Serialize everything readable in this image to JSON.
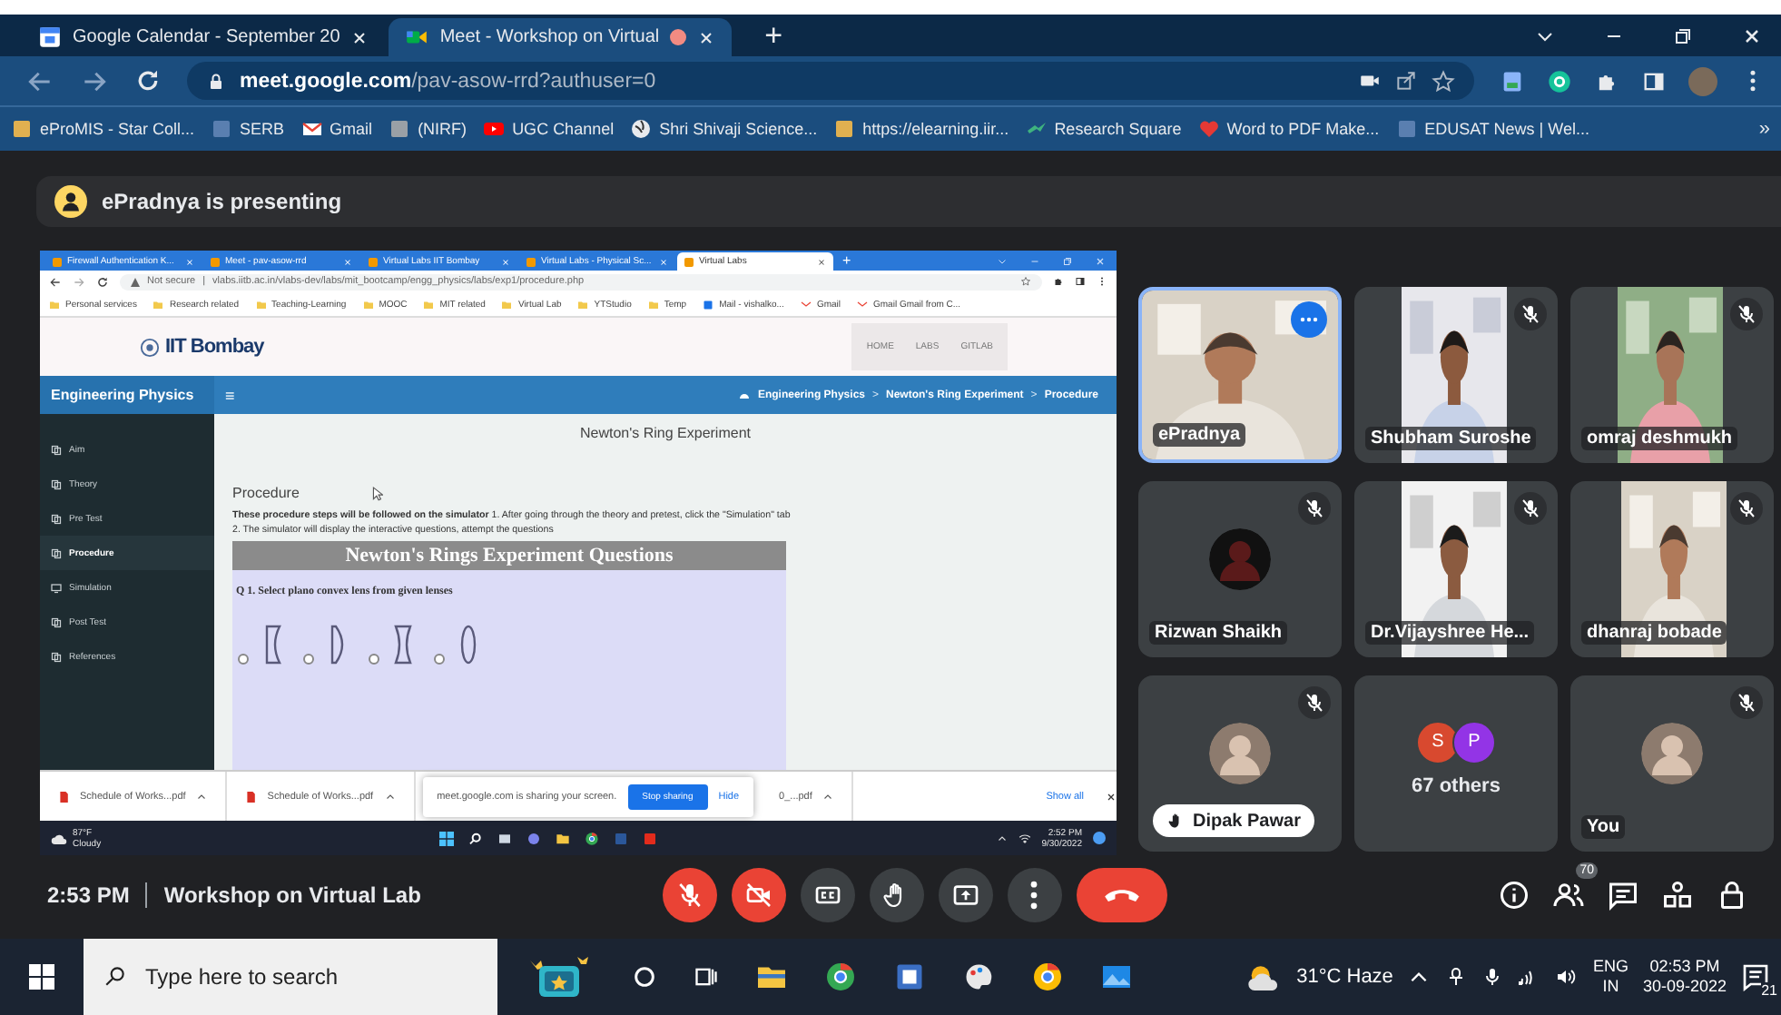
{
  "browser": {
    "tabs": [
      {
        "title": "Google Calendar - September 20",
        "kind": "calendar",
        "selected": false,
        "recording": false
      },
      {
        "title": "Meet - Workshop on Virtual",
        "kind": "meet",
        "selected": true,
        "recording": true
      }
    ],
    "new_tab": "+",
    "url_host": "meet.google.com",
    "url_path": "/pav-asow-rrd?authuser=0",
    "bookmarks": [
      {
        "label": "eProMIS - Star Coll...",
        "kind": "page"
      },
      {
        "label": "SERB",
        "kind": "faint"
      },
      {
        "label": "Gmail",
        "kind": "mail"
      },
      {
        "label": "(NIRF)",
        "kind": "emblem"
      },
      {
        "label": "UGC Channel",
        "kind": "video"
      },
      {
        "label": "Shri Shivaji Science...",
        "kind": "globe"
      },
      {
        "label": "https://elearning.iir...",
        "kind": "page"
      },
      {
        "label": "Research Square",
        "kind": "leaf"
      },
      {
        "label": "Word to PDF Make...",
        "kind": "heart"
      },
      {
        "label": "EDUSAT News | Wel...",
        "kind": "faint"
      }
    ],
    "bookmarks_more": "»"
  },
  "presenting": "ePradnya is presenting",
  "shared_screen": {
    "tabs": [
      {
        "title": "Firewall Authentication K...",
        "selected": false
      },
      {
        "title": "Meet - pav-asow-rrd",
        "selected": false
      },
      {
        "title": "Virtual Labs IIT Bombay",
        "selected": false
      },
      {
        "title": "Virtual Labs - Physical Sc...",
        "selected": false
      },
      {
        "title": "Virtual Labs",
        "selected": true
      }
    ],
    "new_tab": "+",
    "security": "Not secure",
    "separator": "|",
    "url": "vlabs.iitb.ac.in/vlabs-dev/labs/mit_bootcamp/engg_physics/labs/exp1/procedure.php",
    "bookmarks": [
      {
        "label": "Personal services",
        "kind": "folder"
      },
      {
        "label": "Research related",
        "kind": "folder"
      },
      {
        "label": "Teaching-Learning",
        "kind": "folder"
      },
      {
        "label": "MOOC",
        "kind": "folder"
      },
      {
        "label": "MIT related",
        "kind": "folder"
      },
      {
        "label": "Virtual Lab",
        "kind": "folder"
      },
      {
        "label": "YTStudio",
        "kind": "folder"
      },
      {
        "label": "Temp",
        "kind": "folder"
      },
      {
        "label": "Mail - vishalko...",
        "kind": "outlook"
      },
      {
        "label": "Gmail",
        "kind": "mail"
      },
      {
        "label": "Gmail Gmail from C...",
        "kind": "mail"
      }
    ],
    "logo": "IIT Bombay",
    "nav": [
      "HOME",
      "LABS",
      "GITLAB"
    ],
    "section": "Engineering Physics",
    "menu": "≡",
    "breadcrumb": [
      "Engineering Physics",
      "Newton's Ring Experiment",
      "Procedure"
    ],
    "breadcrumb_separator": ">",
    "sidebar": [
      {
        "label": "Aim",
        "kind": "page",
        "selected": false
      },
      {
        "label": "Theory",
        "kind": "page",
        "selected": false
      },
      {
        "label": "Pre Test",
        "kind": "page",
        "selected": false
      },
      {
        "label": "Procedure",
        "kind": "page",
        "selected": true
      },
      {
        "label": "Simulation",
        "kind": "screen",
        "selected": false
      },
      {
        "label": "Post Test",
        "kind": "page",
        "selected": false
      },
      {
        "label": "References",
        "kind": "page",
        "selected": false
      }
    ],
    "page_title": "Newton's Ring Experiment",
    "heading": "Procedure",
    "intro": "**These procedure steps will be followed on the simulator** 1. After going through the theory and pretest, click the \"Simulation\" tab",
    "step_2": "2. The simulator will display the interactive questions, attempt the questions",
    "quiz": {
      "title": "Newton's Rings Experiment Questions",
      "question": "Q 1. Select plano convex lens from given lenses",
      "options": [
        {
          "kind": "plano_concave",
          "selected": false
        },
        {
          "kind": "plano_convex",
          "selected": false
        },
        {
          "kind": "biconcave",
          "selected": false
        },
        {
          "kind": "biconvex",
          "selected": false
        }
      ]
    },
    "downloads": [
      {
        "file": "Schedule of Works...pdf"
      },
      {
        "file": "Schedule of Works...pdf"
      },
      {
        "file": "0_...pdf"
      }
    ],
    "share_notice": {
      "message": "meet.google.com is sharing your screen.",
      "stop": "Stop sharing",
      "hide": "Hide"
    },
    "show_all": "Show all",
    "taskbar": {
      "temperature": "87°F",
      "weather": "Cloudy",
      "time": "2:52 PM",
      "date": "9/30/2022"
    }
  },
  "participants": [
    {
      "name": "ePradnya",
      "kind": "video",
      "muted": false,
      "active": true,
      "hand_raised": false
    },
    {
      "name": "Shubham Suroshe",
      "kind": "portrait_video",
      "muted": true,
      "active": false,
      "hand_raised": false
    },
    {
      "name": "omraj deshmukh",
      "kind": "portrait_video",
      "muted": true,
      "active": false,
      "hand_raised": false
    },
    {
      "name": "Rizwan Shaikh",
      "kind": "avatar",
      "muted": true,
      "active": false,
      "hand_raised": false
    },
    {
      "name": "Dr.Vijayshree He...",
      "kind": "portrait_video",
      "muted": true,
      "active": false,
      "hand_raised": false
    },
    {
      "name": "dhanraj bobade",
      "kind": "portrait_video",
      "muted": true,
      "active": false,
      "hand_raised": false
    },
    {
      "name": "Dipak Pawar",
      "kind": "avatar",
      "muted": true,
      "active": false,
      "hand_raised": true
    },
    {
      "name": "67 others",
      "kind": "others",
      "muted": false,
      "active": false,
      "avatars": [
        {
          "letter": "S",
          "color": "#d8492f"
        },
        {
          "letter": "P",
          "color": "#9334e6"
        }
      ]
    },
    {
      "name": "You",
      "kind": "avatar",
      "muted": true,
      "active": false,
      "hand_raised": false
    }
  ],
  "meeting": {
    "time": "2:53 PM",
    "title": "Workshop on Virtual Lab",
    "controls": [
      {
        "kind": "mic",
        "on": false
      },
      {
        "kind": "camera",
        "on": false
      },
      {
        "kind": "captions",
        "on": false
      },
      {
        "kind": "hand",
        "on": false
      },
      {
        "kind": "present",
        "on": false
      },
      {
        "kind": "more"
      },
      {
        "kind": "leave"
      }
    ],
    "people_count": "70"
  },
  "taskbar": {
    "search_placeholder": "Type here to search",
    "weather": "31°C Haze",
    "language": "ENG",
    "region": "IN",
    "time": "02:53 PM",
    "date": "30-09-2022",
    "notifications": "21"
  }
}
